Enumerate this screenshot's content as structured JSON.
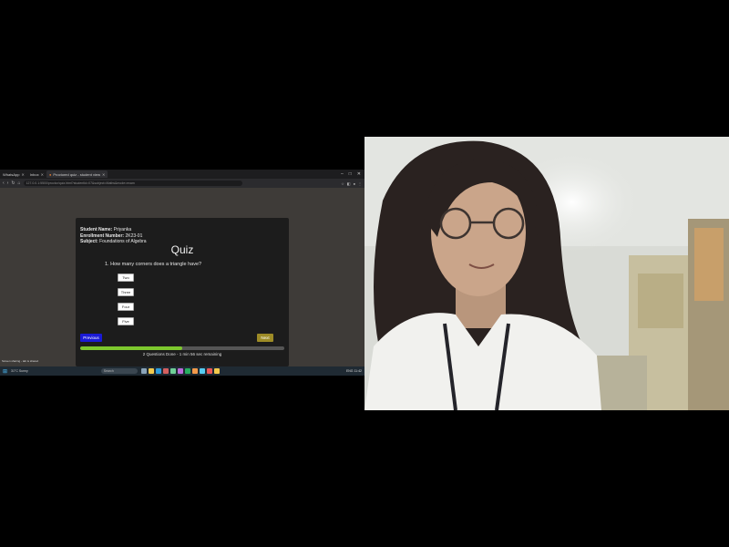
{
  "browser": {
    "tabs": [
      {
        "label": "WhatsApp"
      },
      {
        "label": "Inbox"
      },
      {
        "label": "Proctored quiz - student view",
        "active": true
      }
    ],
    "url": "127.0.0.1:5500/proctor/quiz.html?studentId=07&subject=Maths&mode=exam",
    "window_controls": [
      "–",
      "□",
      "✕"
    ]
  },
  "quiz": {
    "student_label": "Student Name:",
    "student_value": "Priyanka",
    "enrollment_label": "Enrollment Number:",
    "enrollment_value": "2K23-01",
    "subject_label": "Subject:",
    "subject_value": "Foundations of Algebra",
    "title": "Quiz",
    "question": "1. How many corners does a triangle have?",
    "options": [
      "Two",
      "Three",
      "Four",
      "Five"
    ],
    "prev_label": "Previous",
    "next_label": "Next",
    "progress_fraction": 0.5,
    "progress_text": "2 Questions Done - 1 min 56 sec remaining"
  },
  "taskbar": {
    "weather": "31°C Sunny",
    "search_placeholder": "Search",
    "tray": "ENG 11:42",
    "status": "Screen sharing - tab is shared"
  },
  "colors": {
    "progress": "#7dc82e",
    "prev_button": "#1a1ad6",
    "next_button": "#9d8b26"
  }
}
